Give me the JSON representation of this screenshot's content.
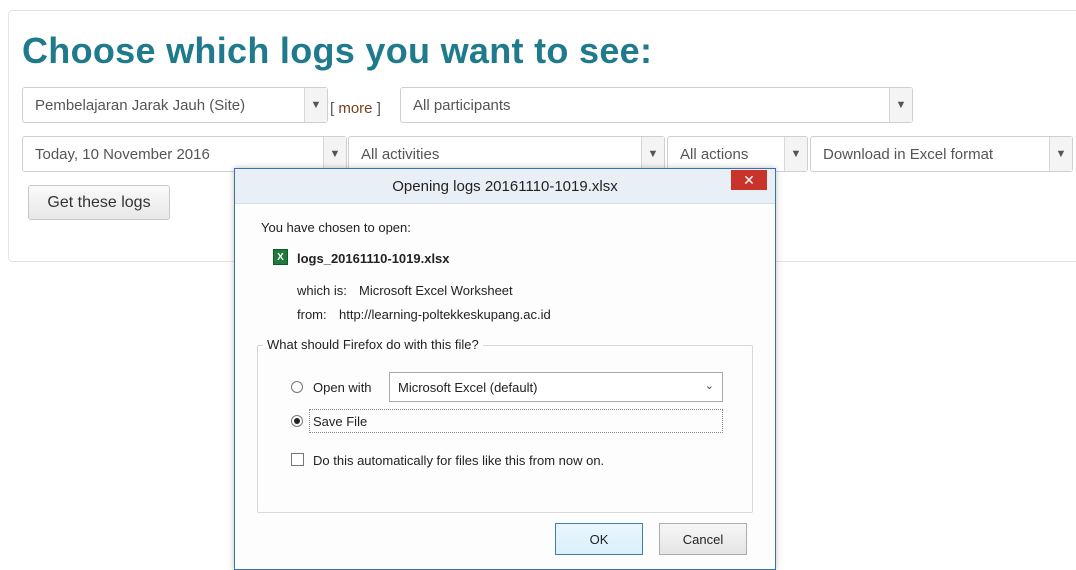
{
  "page": {
    "heading": "Choose which logs you want to see:",
    "site_select": "Pembelajaran Jarak Jauh (Site)",
    "more_link": "more",
    "participants_select": "All participants",
    "date_select": "Today, 10 November 2016",
    "activities_select": "All activities",
    "actions_select": "All actions",
    "format_select": "Download in Excel format",
    "get_logs_button": "Get these logs"
  },
  "dialog": {
    "title": "Opening logs 20161110-1019.xlsx",
    "close_symbol": "✕",
    "intro": "You have chosen to open:",
    "file_icon": "excel-file-icon",
    "file_name": "logs_20161110-1019.xlsx",
    "which_is_label": "which is:",
    "which_is_value": "Microsoft Excel Worksheet",
    "from_label": "from:",
    "from_value": "http://learning-poltekkeskupang.ac.id",
    "question": "What should Firefox do with this file?",
    "open_with_label": "Open with",
    "open_with_app": "Microsoft Excel (default)",
    "save_file_label": "Save File",
    "auto_label": "Do this automatically for files like this from now on.",
    "selected_option": "save_file",
    "ok_button": "OK",
    "cancel_button": "Cancel"
  },
  "colors": {
    "heading": "#1f7a8c",
    "more_link": "#7a3e1a",
    "close_button": "#c9342a",
    "titlebar": "#e9eff6"
  }
}
